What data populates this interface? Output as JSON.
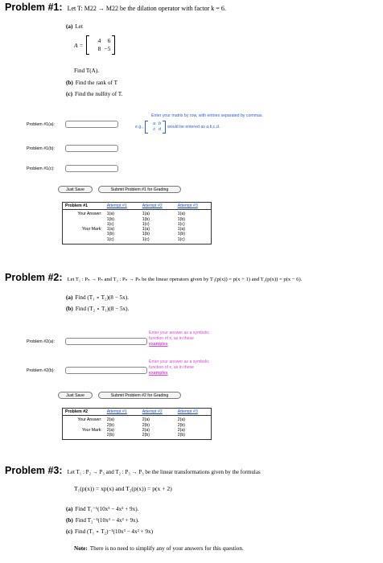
{
  "p1": {
    "title": "Problem #1:",
    "stmt": "Let T: M22 → M22 be the dilation operator with factor k = 6.",
    "a_label": "(a)",
    "a_text": "Let",
    "matrix_name": "A =",
    "matrix": [
      "4",
      "6",
      "8",
      "−5"
    ],
    "find_ta": "Find T(A).",
    "b_label": "(b)",
    "b_text": "Find the rank of T",
    "c_label": "(c)",
    "c_text": "Find the nullity of T.",
    "hint_line1": "Enter your matrix by row, with entries separated by commas.",
    "hint_eg": "e.g.,",
    "hint_mat": [
      "a",
      "b",
      "c",
      "d"
    ],
    "hint_line2": "would be entered as a,b,c,d.",
    "fields": [
      {
        "label": "Problem #1(a):"
      },
      {
        "label": "Problem #1(b):"
      },
      {
        "label": "Problem #1(c):"
      }
    ],
    "save": "Just Save",
    "submit": "Submit Problem #1 for Grading",
    "table": {
      "head": [
        "Problem #1",
        "Attempt #1",
        "Attempt #2",
        "Attempt #3"
      ],
      "your_answer": "Your Answer:",
      "your_mark": "Your Mark:",
      "parts": [
        "1(a)",
        "1(b)",
        "1(c)"
      ]
    }
  },
  "p2": {
    "title": "Problem #2:",
    "stmt": "Let T₁ : Pₙ → Pₙ and T₂ : Pₙ → Pₙ be the linear operators given by T₁(p(x)) = p(x + 1) and T₂(p(x)) = p(x − 6).",
    "a_label": "(a)",
    "a_text": "Find (T₁ ∘ T₂)(8 − 5x).",
    "b_label": "(b)",
    "b_text": "Find (T₂ ∘ T₁)(8 − 5x).",
    "hint1": "Enter your answer as a symbolic",
    "hint2": "function of x, as in these",
    "hint3": "examples",
    "fields": [
      {
        "label": "Problem #2(a):"
      },
      {
        "label": "Problem #2(b):"
      }
    ],
    "save": "Just Save",
    "submit": "Submit Problem #2 for Grading",
    "table": {
      "head": [
        "Problem #2",
        "Attempt #1",
        "Attempt #2",
        "Attempt #3"
      ],
      "your_answer": "Your Answer:",
      "your_mark": "Your Mark:",
      "parts": [
        "2(a)",
        "2(b)"
      ]
    }
  },
  "p3": {
    "title": "Problem #3:",
    "stmt": "Let T₁ : P₂ → P₃ and T₂ : P₃ → P₃ be the linear transformations given by the formulas",
    "formula": "T₁(p(x)) = xp(x)  and  T₂(p(x)) = p(x + 2)",
    "a_label": "(a)",
    "a_text": "Find T₁⁻¹(10x³ − 4x² + 9x).",
    "b_label": "(b)",
    "b_text": "Find T₂⁻¹(10x³ − 4x² + 9x).",
    "c_label": "(c)",
    "c_text": "Find (T₁ ∘ T₂)⁻¹(10x³ − 4x² + 9x)",
    "note_label": "Note:",
    "note_text": "There is no need to simplify any of your answers for this question."
  }
}
